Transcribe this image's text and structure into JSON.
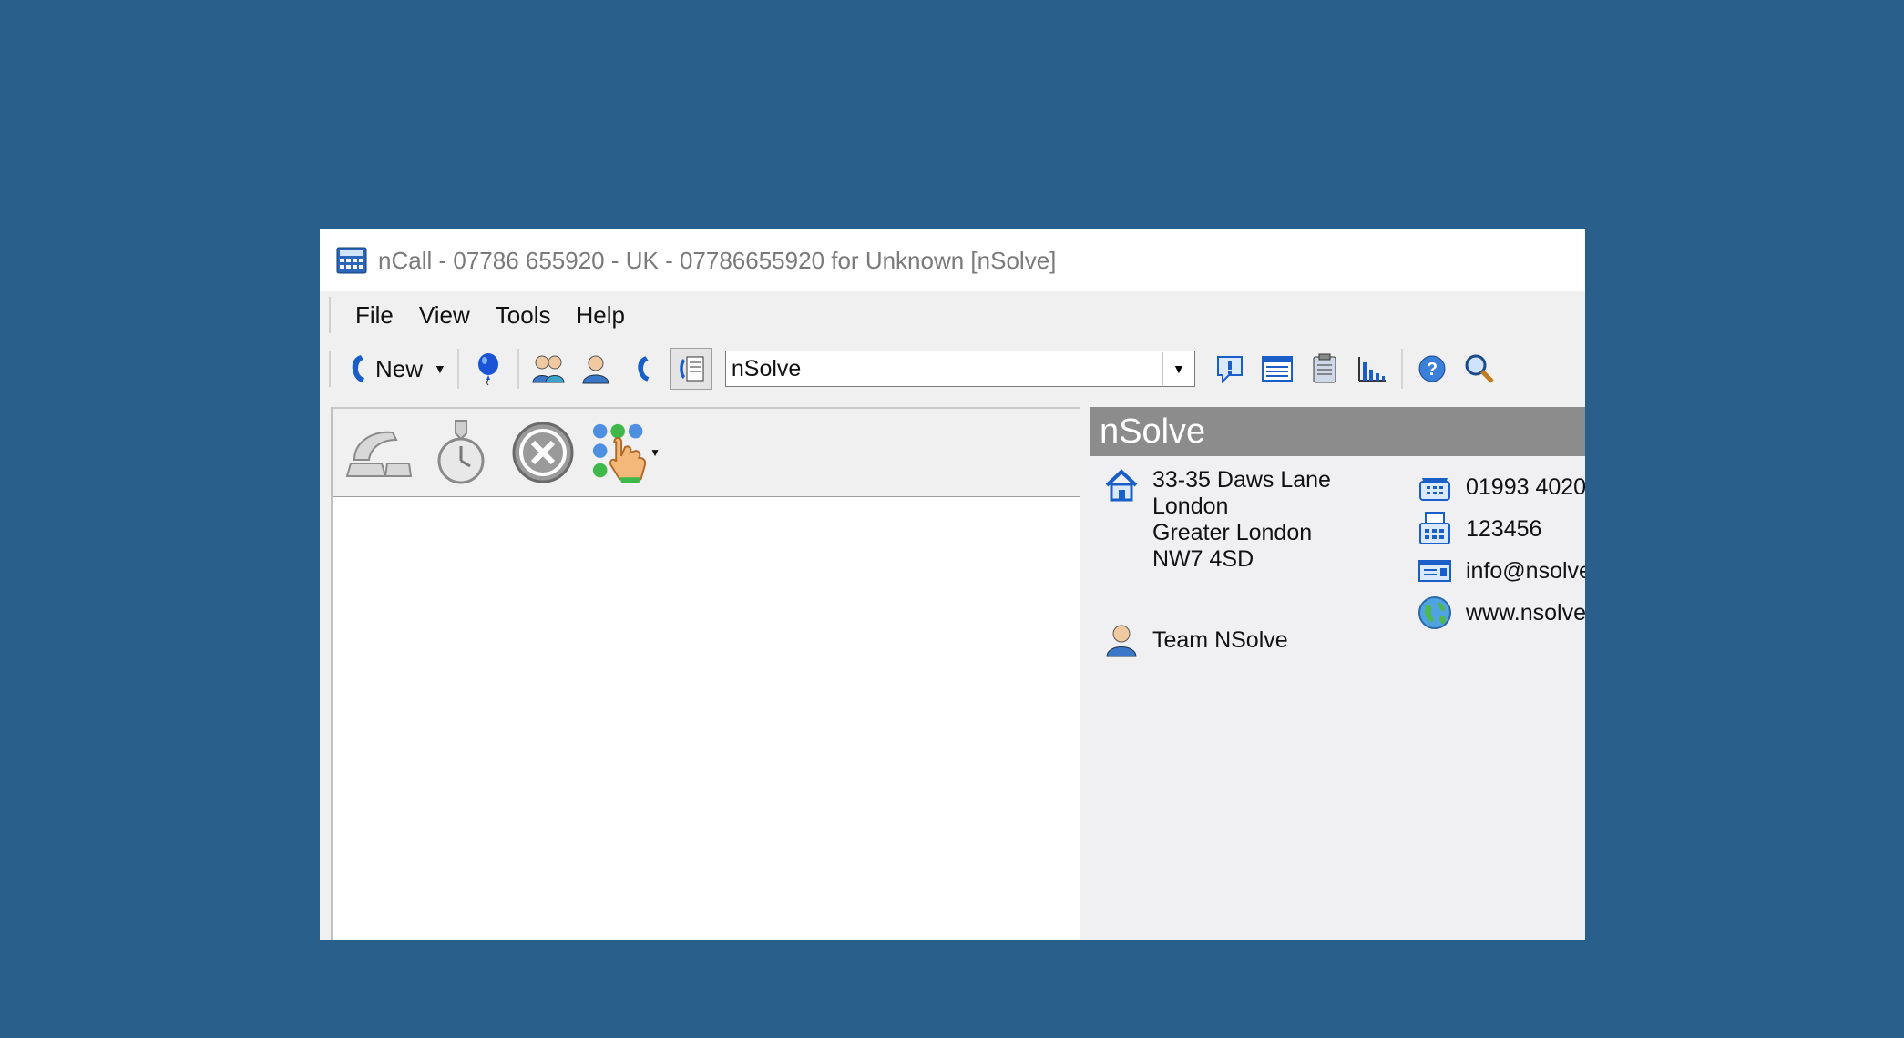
{
  "window": {
    "title": "nCall - 07786 655920 - UK - 07786655920 for Unknown [nSolve]"
  },
  "menu": {
    "file": "File",
    "view": "View",
    "tools": "Tools",
    "help": "Help"
  },
  "toolbar": {
    "new_label": "New",
    "company_selected": "nSolve"
  },
  "company": {
    "name": "nSolve",
    "address": [
      "33-35 Daws Lane",
      "London",
      "Greater London",
      "NW7 4SD"
    ],
    "phone": "01993 4020",
    "fax": "123456",
    "email": "info@nsolve",
    "website": "www.nsolve",
    "contact": "Team NSolve"
  },
  "colors": {
    "desktop": "#285f8b",
    "header": "#8c8c8c",
    "accent": "#1a5fc8"
  }
}
